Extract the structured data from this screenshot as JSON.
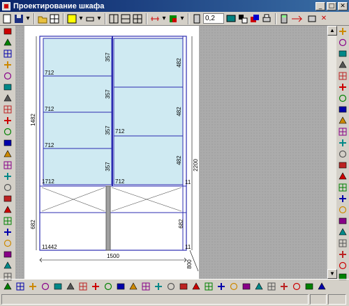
{
  "window": {
    "title": "Проектирование шкафа",
    "minimize": "_",
    "maximize": "□",
    "close": "✕"
  },
  "toolbar": {
    "zoom_value": "0,2"
  },
  "drawing": {
    "overall_width": "1500",
    "overall_height": "2200",
    "depth": "800",
    "top_section_height": "1482",
    "bottom_section_height": "682",
    "bottom_right_height": "682",
    "left_column_width": "712",
    "left_shelf_labels": [
      "712",
      "712",
      "712",
      "1712"
    ],
    "right_shelf_labels": [
      "712",
      "712"
    ],
    "left_shelf_heights": [
      "357",
      "357",
      "357",
      "357"
    ],
    "right_shelf_heights": [
      "482",
      "482",
      "482"
    ],
    "right_side_small": [
      "11",
      "11"
    ],
    "bottom_left_label": "11442"
  },
  "colors": {
    "shelf_fill": "#cfeaf2",
    "frame": "#2b2bb0",
    "workspace": "#ababab",
    "titlebar": "#0a246a"
  }
}
